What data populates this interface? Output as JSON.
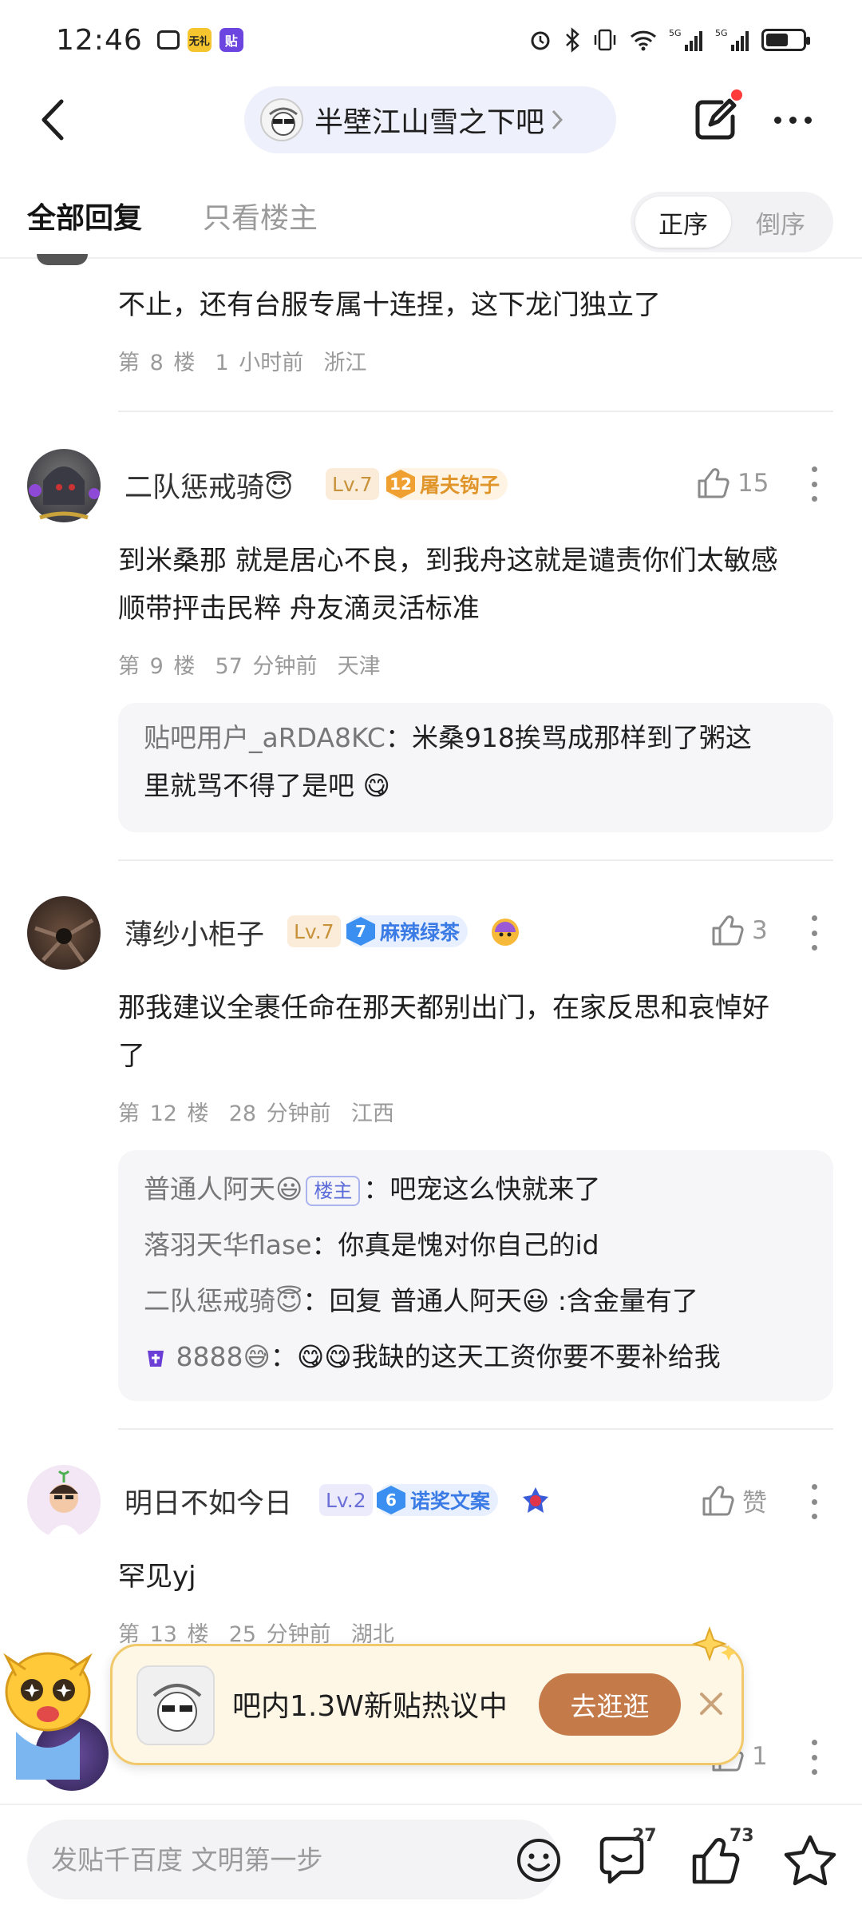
{
  "status_bar": {
    "time": "12:46",
    "apps": [
      {
        "name": "tv-app-icon",
        "label": "",
        "color": "#ffffff"
      },
      {
        "name": "news-app-icon",
        "label": "无礼",
        "color": "#f5c530"
      },
      {
        "name": "tieba-app-icon",
        "label": "贴",
        "color": "#6c45e0"
      }
    ],
    "network": "5G 5G",
    "battery_level": 0.6
  },
  "nav": {
    "forum_name": "半壁江山雪之下吧"
  },
  "tabs": {
    "all_replies": "全部回复",
    "host_only": "只看楼主",
    "order_asc": "正序",
    "order_desc": "倒序"
  },
  "posts": [
    {
      "content": "不止，还有台服专属十连捏，这下龙门独立了",
      "floor": "第 8 楼",
      "time": "1 小时前",
      "location": "浙江"
    },
    {
      "username": "二队惩戒骑😇",
      "level": "Lv.7",
      "badge_num": "12",
      "badge_name": "屠夫钩子",
      "likes": "15",
      "content_lines": [
        "到米桑那 就是居心不良，到我舟这就是谴责你们太敏感",
        "顺带抨击民粹 舟友滴灵活标准"
      ],
      "floor": "第 9 楼",
      "time": "57 分钟前",
      "location": "天津",
      "replies": [
        {
          "user": "贴吧用户_aRDA8KC",
          "text": "：米桑918挨骂成那样到了粥这",
          "text2": "里就骂不得了是吧 😋"
        }
      ]
    },
    {
      "username": "薄纱小柜子",
      "level": "Lv.7",
      "badge_num": "7",
      "badge_name": "麻辣绿茶",
      "likes": "3",
      "content_lines": [
        "那我建议全裹任命在那天都别出门，在家反思和哀悼好",
        "了"
      ],
      "floor": "第 12 楼",
      "time": "28 分钟前",
      "location": "江西",
      "replies": [
        {
          "user": "普通人阿天😃",
          "tag": "楼主",
          "text": "：吧宠这么快就来了"
        },
        {
          "user": "落羽天华flase",
          "text": "：你真是愧对你自己的id"
        },
        {
          "user": "二队惩戒骑😇",
          "text": "：回复 普通人阿天😃 :含金量有了"
        },
        {
          "user": "8888😅",
          "text": "：😋😋我缺的这天工资你要不要补给我"
        }
      ]
    },
    {
      "username": "明日不如今日",
      "level": "Lv.2",
      "badge_num": "6",
      "badge_name": "诺奖文案",
      "likes": "赞",
      "content": "罕见yj",
      "floor": "第 13 楼",
      "time": "25 分钟前",
      "location": "湖北"
    },
    {
      "likes": "1"
    }
  ],
  "promo": {
    "text": "吧内1.3W新贴热议中",
    "button": "去逛逛"
  },
  "bottom": {
    "input_placeholder": "发贴千百度 文明第一步",
    "comment_count": "27",
    "like_count": "73"
  },
  "colors": {
    "accent_orange": "#f0a030",
    "promo_button": "#c47a49",
    "level_gold": "#c8923a",
    "level_purple": "#6b6fd8",
    "badge_blue": "#3b7be6"
  }
}
